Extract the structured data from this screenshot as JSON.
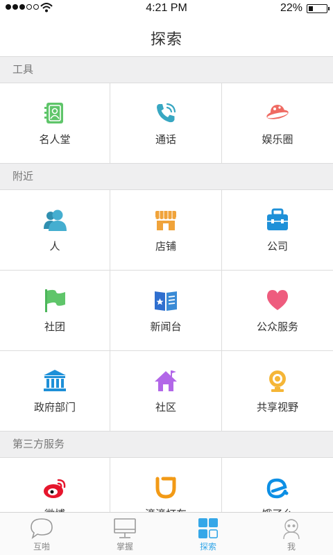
{
  "status_bar": {
    "time": "4:21 PM",
    "battery_percent": "22%",
    "battery_level": 0.22,
    "signal_bars": 3
  },
  "header": {
    "title": "探索"
  },
  "sections": [
    {
      "title": "工具",
      "items": [
        {
          "label": "名人堂",
          "icon": "contacts-book-icon"
        },
        {
          "label": "通话",
          "icon": "phone-call-icon"
        },
        {
          "label": "娱乐圈",
          "icon": "planet-icon"
        }
      ]
    },
    {
      "title": "附近",
      "items": [
        {
          "label": "人",
          "icon": "people-icon"
        },
        {
          "label": "店铺",
          "icon": "storefront-icon"
        },
        {
          "label": "公司",
          "icon": "briefcase-icon"
        },
        {
          "label": "社团",
          "icon": "flag-icon"
        },
        {
          "label": "新闻台",
          "icon": "newspaper-icon"
        },
        {
          "label": "公众服务",
          "icon": "heart-icon"
        },
        {
          "label": "政府部门",
          "icon": "government-building-icon"
        },
        {
          "label": "社区",
          "icon": "house-icon"
        },
        {
          "label": "共享视野",
          "icon": "webcam-icon"
        }
      ]
    },
    {
      "title": "第三方服务",
      "items": [
        {
          "label": "微博",
          "icon": "weibo-icon"
        },
        {
          "label": "滴滴打车",
          "icon": "didi-icon"
        },
        {
          "label": "饿了么",
          "icon": "eleme-icon"
        }
      ]
    }
  ],
  "tabs": [
    {
      "label": "互啪",
      "icon": "chat-bubble-icon",
      "active": false
    },
    {
      "label": "掌握",
      "icon": "monitor-icon",
      "active": false
    },
    {
      "label": "探索",
      "icon": "grid-apps-icon",
      "active": true
    },
    {
      "label": "我",
      "icon": "avatar-icon",
      "active": false
    }
  ],
  "colors": {
    "accent": "#35a7e8",
    "section_bg": "#efeff0",
    "divider": "#dcdcdc",
    "green": "#5fc56a",
    "teal": "#38a7c2",
    "coral": "#ef6a62",
    "orange": "#f0a33a",
    "blue": "#3a8bd6",
    "pink": "#ee5c7e",
    "purple": "#b267e8",
    "yellow": "#f5b637",
    "weibo_red": "#e6162d",
    "didi_orange": "#f29a16",
    "eleme_blue": "#0d8fe5"
  }
}
